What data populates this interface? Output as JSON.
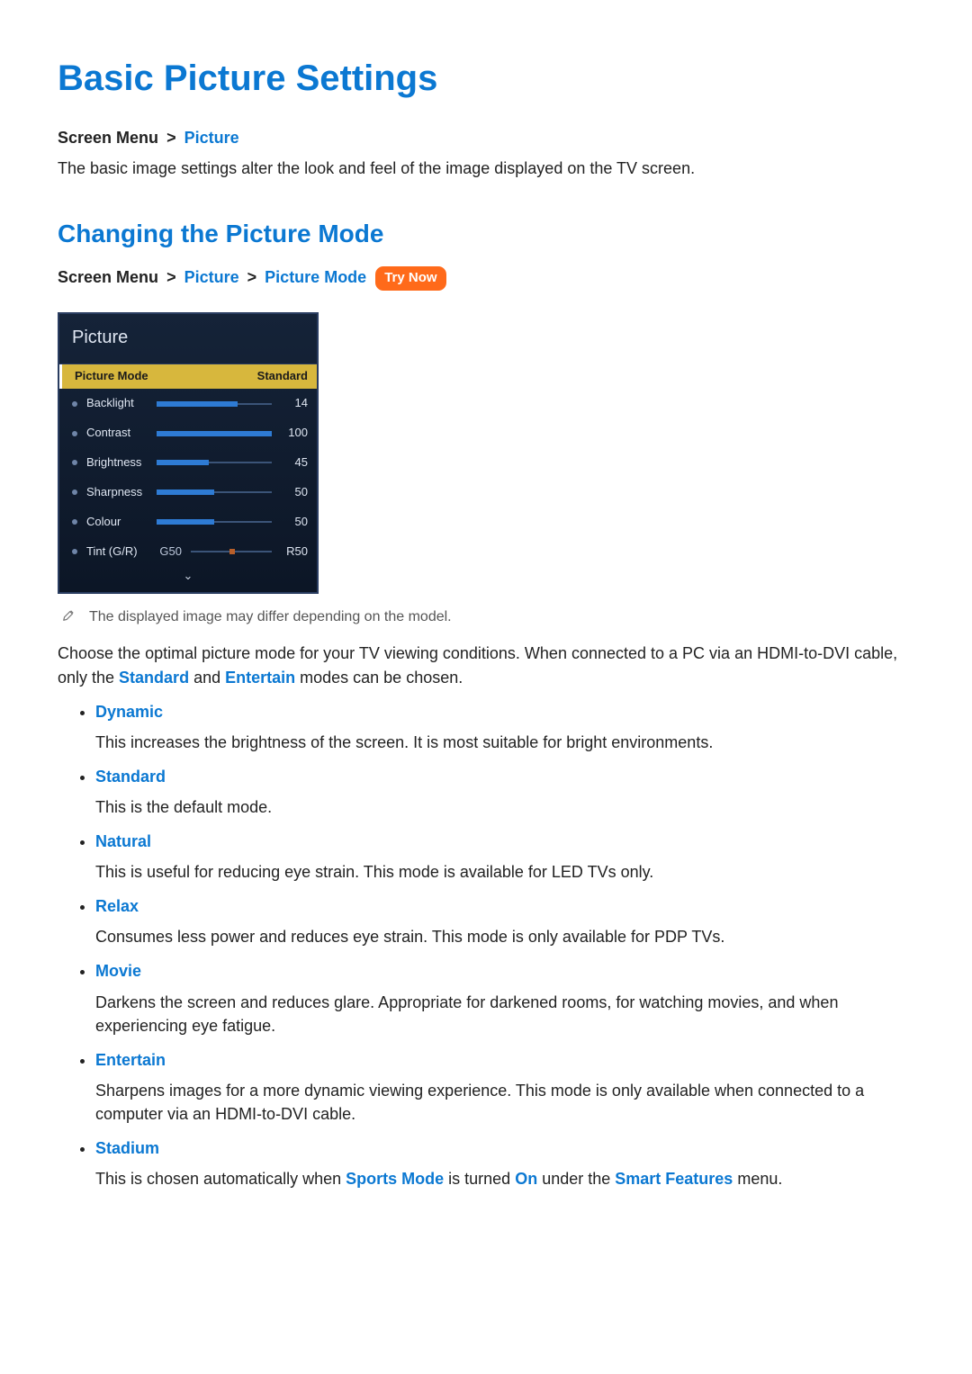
{
  "titles": {
    "h1": "Basic Picture Settings",
    "h2": "Changing the Picture Mode"
  },
  "breadcrumb1": {
    "prefix": "Screen Menu",
    "sep": ">",
    "link": "Picture"
  },
  "intro": "The basic image settings alter the look and feel of the image displayed on the TV screen.",
  "breadcrumb2": {
    "prefix": "Screen Menu",
    "sep1": ">",
    "link1": "Picture",
    "sep2": ">",
    "link2": "Picture Mode",
    "try_now": "Try Now"
  },
  "osd": {
    "title": "Picture",
    "selected": {
      "label": "Picture Mode",
      "value": "Standard"
    },
    "rows": [
      {
        "label": "Backlight",
        "value": "14",
        "pct": 70
      },
      {
        "label": "Contrast",
        "value": "100",
        "pct": 100
      },
      {
        "label": "Brightness",
        "value": "45",
        "pct": 45
      },
      {
        "label": "Sharpness",
        "value": "50",
        "pct": 50
      },
      {
        "label": "Colour",
        "value": "50",
        "pct": 50
      }
    ],
    "tint": {
      "label": "Tint (G/R)",
      "left": "G50",
      "right": "R50"
    },
    "more": "⌄"
  },
  "note": "The displayed image may differ depending on the model.",
  "para": {
    "p1": "Choose the optimal picture mode for your TV viewing conditions. When connected to a PC via an HDMI-to-DVI cable, only the ",
    "h1": "Standard",
    "p2": " and ",
    "h2": "Entertain",
    "p3": " modes can be chosen."
  },
  "modes": [
    {
      "name": "Dynamic",
      "desc": "This increases the brightness of the screen. It is most suitable for bright environments."
    },
    {
      "name": "Standard",
      "desc": "This is the default mode."
    },
    {
      "name": "Natural",
      "desc": "This is useful for reducing eye strain. This mode is available for LED TVs only."
    },
    {
      "name": "Relax",
      "desc": "Consumes less power and reduces eye strain. This mode is only available for PDP TVs."
    },
    {
      "name": "Movie",
      "desc": "Darkens the screen and reduces glare. Appropriate for darkened rooms, for watching movies, and when experiencing eye fatigue."
    },
    {
      "name": "Entertain",
      "desc": "Sharpens images for a more dynamic viewing experience. This mode is only available when connected to a computer via an HDMI-to-DVI cable."
    }
  ],
  "stadium": {
    "name": "Stadium",
    "p1": "This is chosen automatically when ",
    "h1": "Sports Mode",
    "p2": " is turned ",
    "h2": "On",
    "p3": " under the ",
    "h3": "Smart Features",
    "p4": " menu."
  }
}
